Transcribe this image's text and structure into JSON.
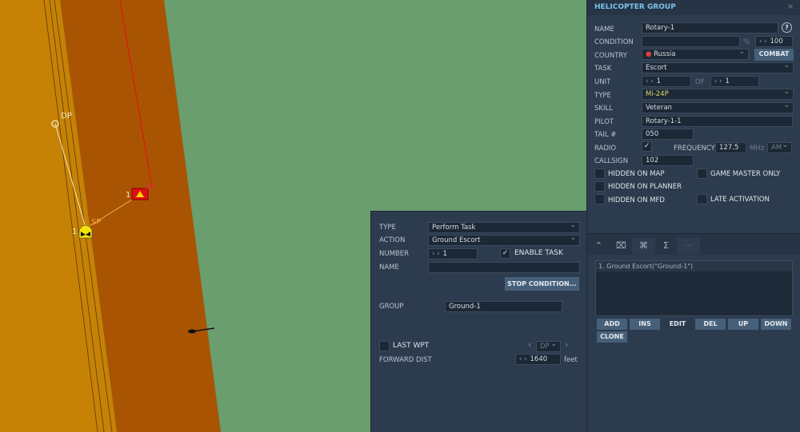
{
  "map": {
    "waypoint_dp": "DP",
    "waypoint_sp": "SP",
    "enemy_sp": "SP",
    "heli_group_number": "1",
    "enemy_group_number": "1",
    "colors": {
      "terrain_light": "#c68204",
      "terrain_dark": "#a95403",
      "terrain_green": "#6a9e6e",
      "route_red": "#e01010"
    }
  },
  "group_panel": {
    "title": "HELICOPTER GROUP",
    "close_icon": "close-icon",
    "name_label": "NAME",
    "name_value": "Rotary-1",
    "help": "?",
    "condition_label": "CONDITION",
    "condition_value": "",
    "percent": "%",
    "condition_pct": "100",
    "country_label": "COUNTRY",
    "country_value": "Russia",
    "combat_label": "COMBAT",
    "task_label": "TASK",
    "task_value": "Escort",
    "unit_label": "UNIT",
    "unit_value": "1",
    "of_label": "OF",
    "unit_total": "1",
    "type_label": "TYPE",
    "type_value": "Mi-24P",
    "skill_label": "SKILL",
    "skill_value": "Veteran",
    "pilot_label": "PILOT",
    "pilot_value": "Rotary-1-1",
    "tail_label": "TAIL #",
    "tail_value": "050",
    "radio_label": "RADIO",
    "radio_checked": true,
    "frequency_label": "FREQUENCY",
    "frequency_value": "127.5",
    "mhz": "MHz",
    "modulation": "AM",
    "callsign_label": "CALLSIGN",
    "callsign_value": "102",
    "hidden_map": "HIDDEN ON MAP",
    "game_master": "GAME MASTER ONLY",
    "hidden_planner": "HIDDEN ON PLANNER",
    "hidden_mfd": "HIDDEN ON MFD",
    "late_activation": "LATE ACTIVATION"
  },
  "tabs": [
    {
      "icon": "route-icon",
      "glyph": "⌃"
    },
    {
      "icon": "target-icon",
      "glyph": "⌧"
    },
    {
      "icon": "command-icon",
      "glyph": "⌘"
    },
    {
      "icon": "sum-icon",
      "glyph": "Σ"
    },
    {
      "icon": "more-icon",
      "glyph": "···"
    }
  ],
  "task_list": {
    "items": [
      "1. Ground Escort(\"Ground-1\")"
    ],
    "buttons": [
      "ADD",
      "INS",
      "EDIT",
      "DEL",
      "UP",
      "DOWN",
      "CLONE"
    ]
  },
  "task_panel": {
    "type_label": "TYPE",
    "type_value": "Perform Task",
    "action_label": "ACTION",
    "action_value": "Ground Escort",
    "number_label": "NUMBER",
    "number_value": "1",
    "enable_task": "ENABLE TASK",
    "enable_checked": true,
    "name_label": "NAME",
    "name_value": "",
    "stop_condition": "STOP CONDITION...",
    "group_label": "GROUP",
    "group_value": "Ground-1",
    "last_wpt": "LAST WPT",
    "last_wpt_value": "DP",
    "forward_dist_label": "FORWARD DIST",
    "forward_dist_value": "1640",
    "feet": "feet"
  }
}
